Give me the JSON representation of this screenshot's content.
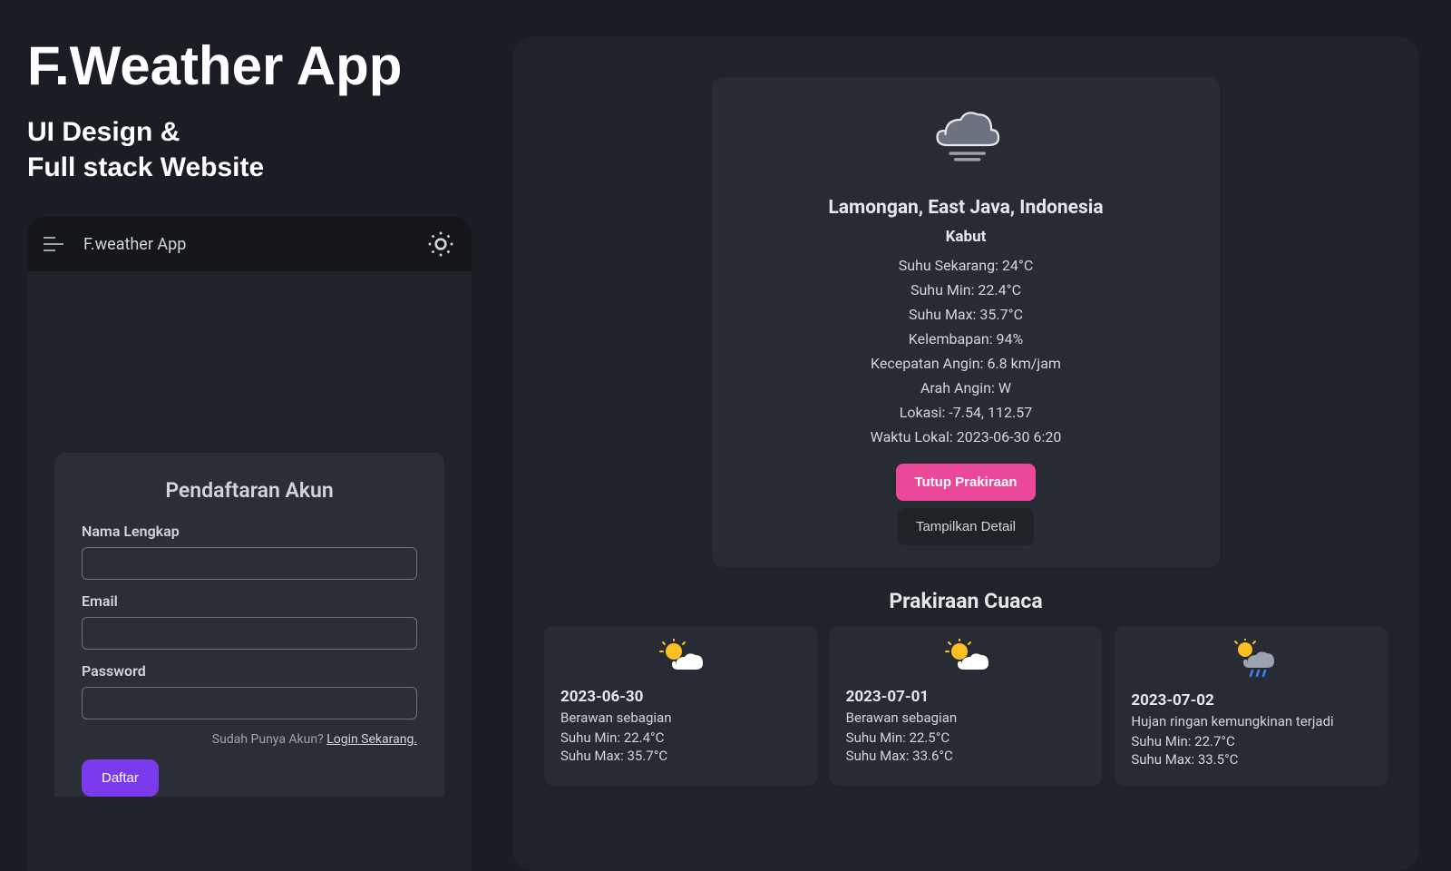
{
  "title": {
    "main": "F.Weather App",
    "sub": "UI Design & Full stack Website"
  },
  "mobile": {
    "app_name": "F.weather App",
    "form": {
      "heading": "Pendaftaran Akun",
      "name_label": "Nama Lengkap",
      "email_label": "Email",
      "password_label": "Password",
      "login_prompt": "Sudah Punya Akun? ",
      "login_link": "Login Sekarang.",
      "submit": "Daftar"
    }
  },
  "weather": {
    "location": "Lamongan, East Java, Indonesia",
    "condition": "Kabut",
    "details": {
      "temp_now": "Suhu Sekarang: 24°C",
      "temp_min": "Suhu Min: 22.4°C",
      "temp_max": "Suhu Max: 35.7°C",
      "humidity": "Kelembapan: 94%",
      "wind_speed": "Kecepatan Angin: 6.8 km/jam",
      "wind_dir": "Arah Angin: W",
      "coords": "Lokasi: -7.54, 112.57",
      "local_time": "Waktu Lokal: 2023-06-30 6:20"
    },
    "btn_close": "Tutup Prakiraan",
    "btn_detail": "Tampilkan Detail",
    "forecast_title": "Prakiraan Cuaca",
    "forecast": [
      {
        "date": "2023-06-30",
        "condition": "Berawan sebagian",
        "min": "Suhu Min: 22.4°C",
        "max": "Suhu Max: 35.7°C",
        "icon": "partly-cloudy"
      },
      {
        "date": "2023-07-01",
        "condition": "Berawan sebagian",
        "min": "Suhu Min: 22.5°C",
        "max": "Suhu Max: 33.6°C",
        "icon": "partly-cloudy"
      },
      {
        "date": "2023-07-02",
        "condition": "Hujan ringan kemungkinan terjadi",
        "min": "Suhu Min: 22.7°C",
        "max": "Suhu Max: 33.5°C",
        "icon": "rain-possible"
      }
    ]
  }
}
